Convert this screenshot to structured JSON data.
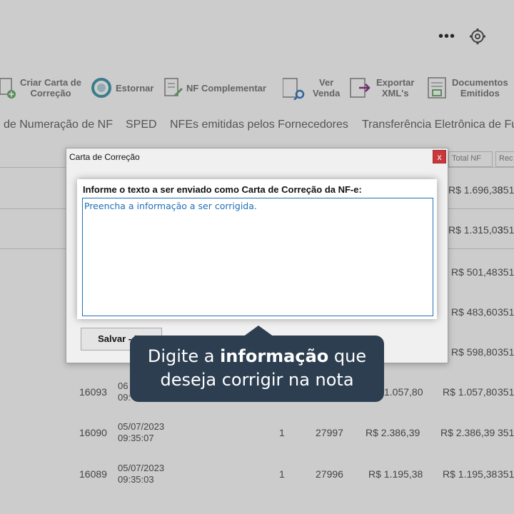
{
  "topbar": {
    "more_icon": "more-horizontal-icon",
    "settings_icon": "gear-icon"
  },
  "toolbar": {
    "items": [
      {
        "label": "Criar Carta de\nCorreção",
        "icon": "document-add-icon"
      },
      {
        "label": "Estornar",
        "icon": "undo-icon"
      },
      {
        "label": "NF Complementar",
        "icon": "document-edit-icon"
      },
      {
        "label": "Ver\nVenda",
        "icon": "search-document-icon"
      },
      {
        "label": "Exportar\nXML's",
        "icon": "export-icon"
      },
      {
        "label": "Documentos\nEmitidos",
        "icon": "documents-icon"
      }
    ]
  },
  "menu": {
    "items": [
      "de Numeração de NF",
      "SPED",
      "NFEs emitidas pelos Fornecedores",
      "Transferência Eletrônica de Fu"
    ]
  },
  "grid": {
    "headers": [
      "Total NF",
      "Rec"
    ],
    "rows": [
      {
        "total": "R$ 1.696,38",
        "tail": "351"
      },
      {
        "total": "R$ 1.315,03",
        "tail": "351"
      },
      {
        "total": "R$ 501,48",
        "tail": "351"
      },
      {
        "total": "R$ 483,60",
        "tail": "351"
      },
      {
        "total": "R$ 598,80",
        "tail": "351"
      },
      {
        "id": "16093",
        "date": "06",
        "time": "09:",
        "subtotal": "1.057,80",
        "total": "R$ 1.057,80",
        "tail": "351"
      },
      {
        "id": "16090",
        "date": "05/07/2023",
        "time": "09:35:07",
        "qty": "1",
        "nf": "27997",
        "subtotal": "R$ 2.386,39",
        "total": "R$ 2.386,39",
        "tail": "351"
      },
      {
        "id": "16089",
        "date": "05/07/2023",
        "time": "09:35:03",
        "qty": "1",
        "nf": "27996",
        "subtotal": "R$ 1.195,38",
        "total": "R$ 1.195,38",
        "tail": "351"
      }
    ]
  },
  "dialog": {
    "title": "Carta de Correção",
    "close_label": "x",
    "prompt_label": "Informe o texto a ser enviado como Carta de Correção da NF-e:",
    "text_value": "Preencha a informação a ser corrigida.",
    "save_label": "Salvar - F5"
  },
  "tooltip": {
    "line1_pre": "Digite a ",
    "line1_bold": "informação",
    "line1_post": " que",
    "line2": "deseja corrigir na nota"
  }
}
